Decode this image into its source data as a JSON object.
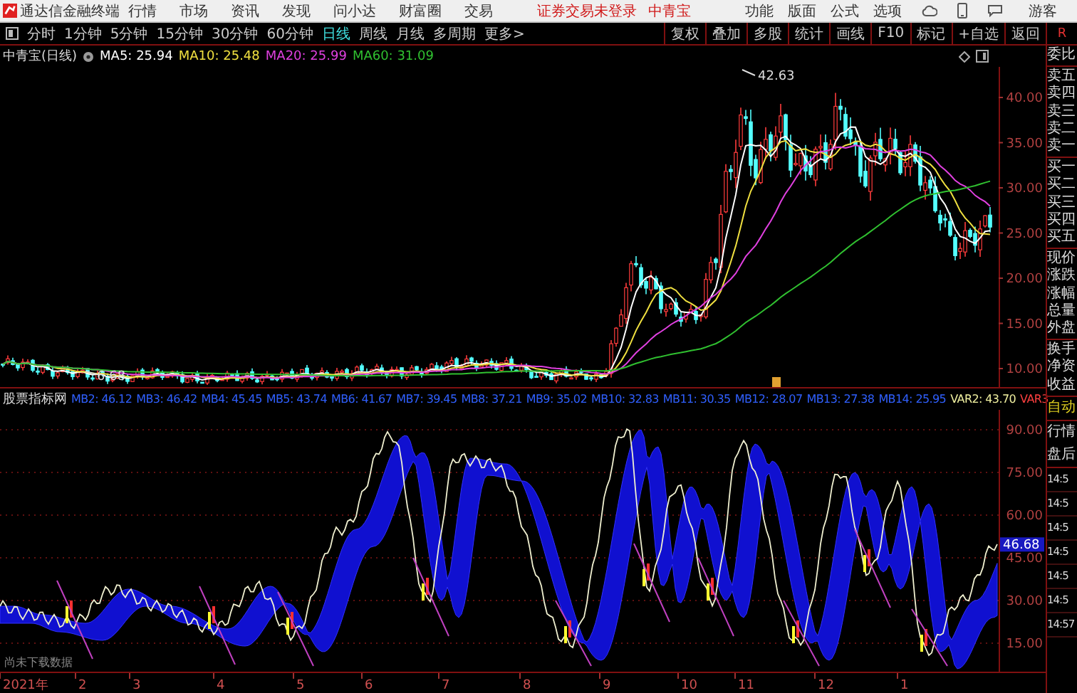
{
  "menu_bar": {
    "app_title": "通达信金融终端",
    "items": [
      "行情",
      "市场",
      "资讯",
      "发现",
      "问小达",
      "财富圈",
      "交易"
    ],
    "login_status": "证券交易未登录",
    "stock": "中青宝",
    "tools": [
      "功能",
      "版面",
      "公式",
      "选项"
    ],
    "user": "游客"
  },
  "period_bar": {
    "periods": [
      {
        "label": "分时",
        "selected": false
      },
      {
        "label": "1分钟",
        "selected": false
      },
      {
        "label": "5分钟",
        "selected": false
      },
      {
        "label": "15分钟",
        "selected": false
      },
      {
        "label": "30分钟",
        "selected": false
      },
      {
        "label": "60分钟",
        "selected": false
      },
      {
        "label": "日线",
        "selected": true
      },
      {
        "label": "周线",
        "selected": false
      },
      {
        "label": "月线",
        "selected": false
      },
      {
        "label": "多周期",
        "selected": false
      },
      {
        "label": "更多>",
        "selected": false
      }
    ],
    "actions": [
      "复权",
      "叠加",
      "多股",
      "统计",
      "画线",
      "F10",
      "标记",
      "+自选",
      "返回"
    ],
    "flag": "R"
  },
  "main_chart": {
    "title": "中青宝(日线)",
    "ma": [
      {
        "label": "MA5: 25.94",
        "color": "#ffffff"
      },
      {
        "label": "MA10: 25.48",
        "color": "#f0e040"
      },
      {
        "label": "MA20: 25.99",
        "color": "#e040e0"
      },
      {
        "label": "MA60: 31.09",
        "color": "#30c030"
      }
    ],
    "high_label": "42.63",
    "low_label": "6.68",
    "price_ticks": [
      "40.00",
      "35.00",
      "30.00",
      "25.00",
      "20.00",
      "15.00",
      "10.00"
    ]
  },
  "indicator": {
    "name": "股票指标网",
    "values": [
      {
        "label": "MB2: 46.12",
        "color": "#3060ff"
      },
      {
        "label": "MB3: 46.42",
        "color": "#3060ff"
      },
      {
        "label": "MB4: 45.45",
        "color": "#3060ff"
      },
      {
        "label": "MB5: 43.74",
        "color": "#3060ff"
      },
      {
        "label": "MB6: 41.67",
        "color": "#3060ff"
      },
      {
        "label": "MB7: 39.45",
        "color": "#3060ff"
      },
      {
        "label": "MB8: 37.21",
        "color": "#3060ff"
      },
      {
        "label": "MB9: 35.02",
        "color": "#3060ff"
      },
      {
        "label": "MB10: 32.83",
        "color": "#3060ff"
      },
      {
        "label": "MB11: 30.35",
        "color": "#3060ff"
      },
      {
        "label": "MB12: 28.07",
        "color": "#3060ff"
      },
      {
        "label": "MB13: 27.38",
        "color": "#3060ff"
      },
      {
        "label": "MB14: 25.95",
        "color": "#3060ff"
      },
      {
        "label": "VAR2: 43.70",
        "color": "#f0f0a0"
      },
      {
        "label": "VAR3",
        "color": "#ff4040"
      }
    ],
    "ticks": [
      "90.00",
      "75.00",
      "60.00",
      "45.00",
      "30.00",
      "15.00"
    ],
    "current": "46.68",
    "note": "尚未下载数据"
  },
  "date_axis": [
    "2021年",
    "2",
    "3",
    "4",
    "5",
    "6",
    "7",
    "8",
    "9",
    "10",
    "11",
    "12",
    "1"
  ],
  "side_panel": {
    "groups": [
      [
        "委比"
      ],
      [
        "卖五",
        "卖四",
        "卖三",
        "卖二",
        "卖一"
      ],
      [
        "买一",
        "买二",
        "买三",
        "买四",
        "买五"
      ],
      [
        "现价",
        "涨跌",
        "涨幅",
        "总量",
        "外盘"
      ],
      [
        "换手",
        "净资",
        "收益"
      ]
    ],
    "mode": "自动",
    "tabs": [
      "行情",
      "盘后"
    ],
    "times": [
      "14:5",
      "14:5",
      "14:5",
      "14:5",
      "14:5",
      "14:5",
      "14:57"
    ]
  }
}
